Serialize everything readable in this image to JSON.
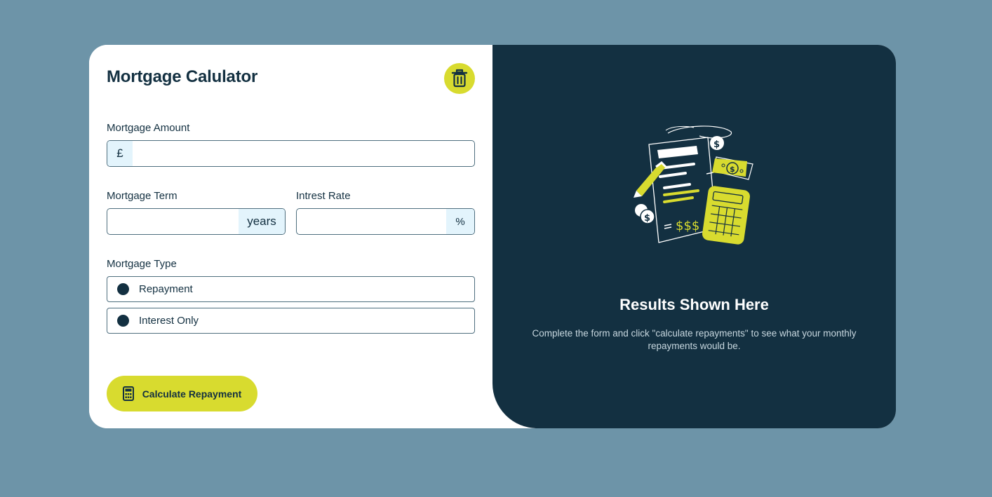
{
  "form": {
    "title": "Mortgage Calulator",
    "clear_icon": "trash-icon",
    "amount": {
      "label": "Mortgage Amount",
      "prefix": "£",
      "value": ""
    },
    "term": {
      "label": "Mortgage Term",
      "suffix": "years",
      "value": ""
    },
    "rate": {
      "label": "Intrest Rate",
      "suffix": "%",
      "value": ""
    },
    "type": {
      "label": "Mortgage Type",
      "options": [
        {
          "label": "Repayment"
        },
        {
          "label": "Interest Only"
        }
      ]
    },
    "submit": {
      "label": "Calculate Repayment",
      "icon": "calculator-icon"
    }
  },
  "results": {
    "illustration": "empty-results-illustration",
    "title": "Results Shown Here",
    "description": "Complete the form and click \"calculate repayments\" to see what your monthly repayments would be."
  },
  "colors": {
    "page_background": "#6d94a8",
    "accent": "#d8db2f",
    "dark": "#133041",
    "addon_background": "#e3f4fc"
  }
}
